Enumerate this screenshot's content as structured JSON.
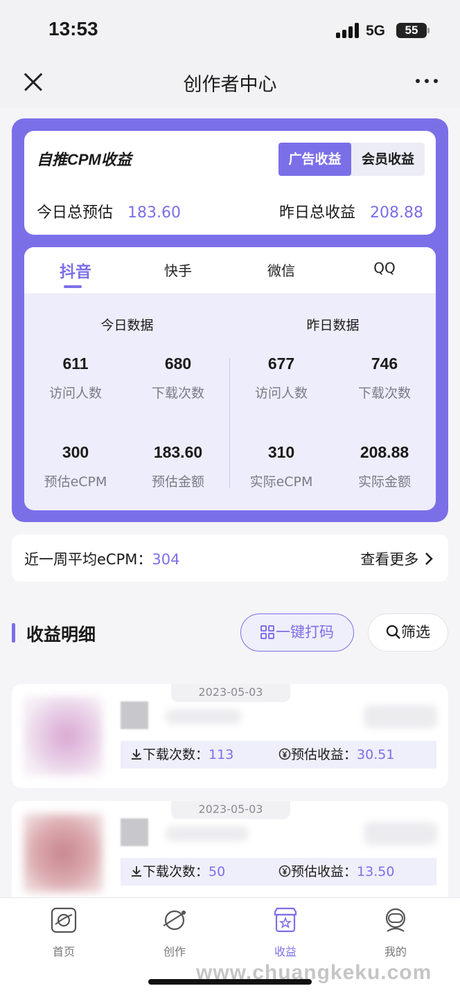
{
  "status_bar": {
    "time": "13:53",
    "network": "5G",
    "battery": "55"
  },
  "nav": {
    "title": "创作者中心"
  },
  "cpm_card": {
    "title": "自推CPM收益",
    "segments": [
      "广告收益",
      "会员收益"
    ],
    "today_label": "今日总预估",
    "today_value": "183.60",
    "yesterday_label": "昨日总收益",
    "yesterday_value": "208.88"
  },
  "platform_tabs": [
    "抖音",
    "快手",
    "微信",
    "QQ"
  ],
  "today": {
    "label": "今日数据",
    "stats": [
      {
        "value": "611",
        "label": "访问人数"
      },
      {
        "value": "680",
        "label": "下载次数"
      },
      {
        "value": "300",
        "label": "预估eCPM"
      },
      {
        "value": "183.60",
        "label": "预估金额"
      }
    ]
  },
  "yesterday": {
    "label": "昨日数据",
    "stats": [
      {
        "value": "677",
        "label": "访问人数"
      },
      {
        "value": "746",
        "label": "下载次数"
      },
      {
        "value": "310",
        "label": "实际eCPM"
      },
      {
        "value": "208.88",
        "label": "实际金额"
      }
    ]
  },
  "week": {
    "label": "近一周平均eCPM：",
    "value": "304",
    "more": "查看更多"
  },
  "detail": {
    "title": "收益明细",
    "code_button": "一键打码",
    "filter_button": "筛选"
  },
  "items": [
    {
      "date": "2023-05-03",
      "downloads_label": "下载次数：",
      "downloads": "113",
      "income_label": "预估收益：",
      "income": "30.51"
    },
    {
      "date": "2023-05-03",
      "downloads_label": "下载次数：",
      "downloads": "50",
      "income_label": "预估收益：",
      "income": "13.50"
    }
  ],
  "tabbar": [
    {
      "label": "首页",
      "icon": "planet-icon"
    },
    {
      "label": "创作",
      "icon": "satellite-icon"
    },
    {
      "label": "收益",
      "icon": "shop-icon"
    },
    {
      "label": "我的",
      "icon": "astronaut-icon"
    }
  ],
  "watermark": "www.chuangkeku.com",
  "colors": {
    "accent": "#7b6fe8",
    "background": "#f5f5f7"
  }
}
